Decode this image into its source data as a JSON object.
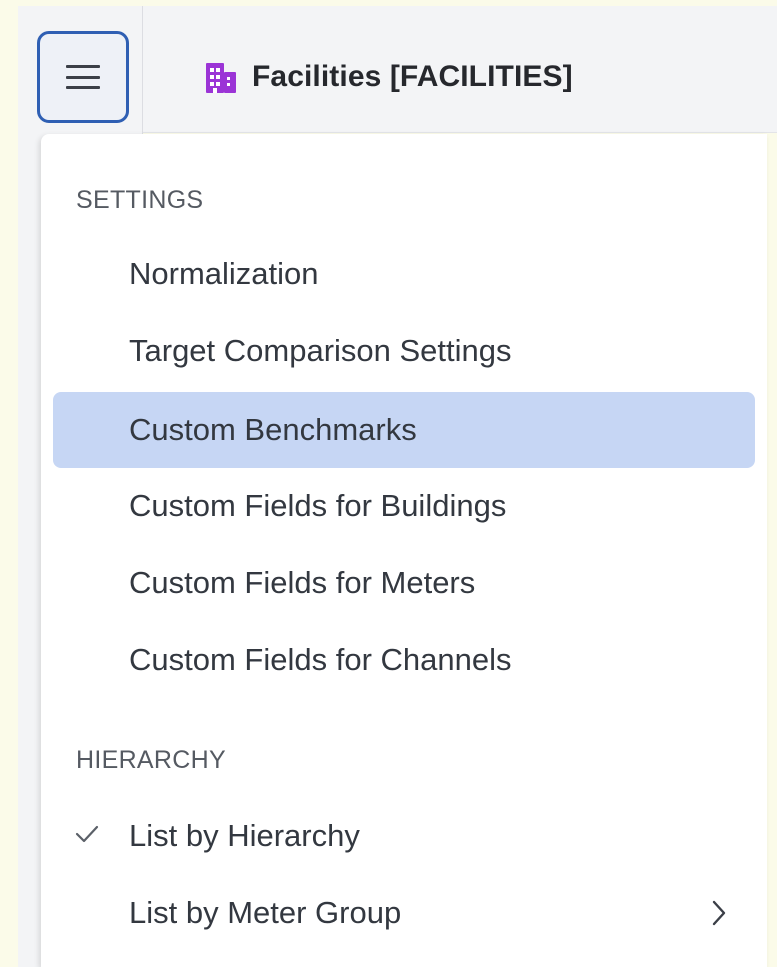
{
  "header": {
    "title": "Facilities [FACILITIES]",
    "title_icon": "building-icon",
    "menu_icon": "hamburger-icon"
  },
  "menu": {
    "sections": [
      {
        "label": "SETTINGS",
        "items": [
          {
            "label": "Normalization"
          },
          {
            "label": "Target Comparison Settings"
          },
          {
            "label": "Custom Benchmarks",
            "highlighted": true
          },
          {
            "label": "Custom Fields for Buildings"
          },
          {
            "label": "Custom Fields for Meters"
          },
          {
            "label": "Custom Fields for Channels"
          }
        ]
      },
      {
        "label": "HIERARCHY",
        "items": [
          {
            "label": "List by Hierarchy",
            "checked": true
          },
          {
            "label": "List by Meter Group",
            "submenu": true
          }
        ]
      }
    ]
  },
  "colors": {
    "accent": "#2f5fb3",
    "highlight": "#c6d6f4",
    "icon_purple": "#9b34d6",
    "background": "#fbfbe9"
  }
}
